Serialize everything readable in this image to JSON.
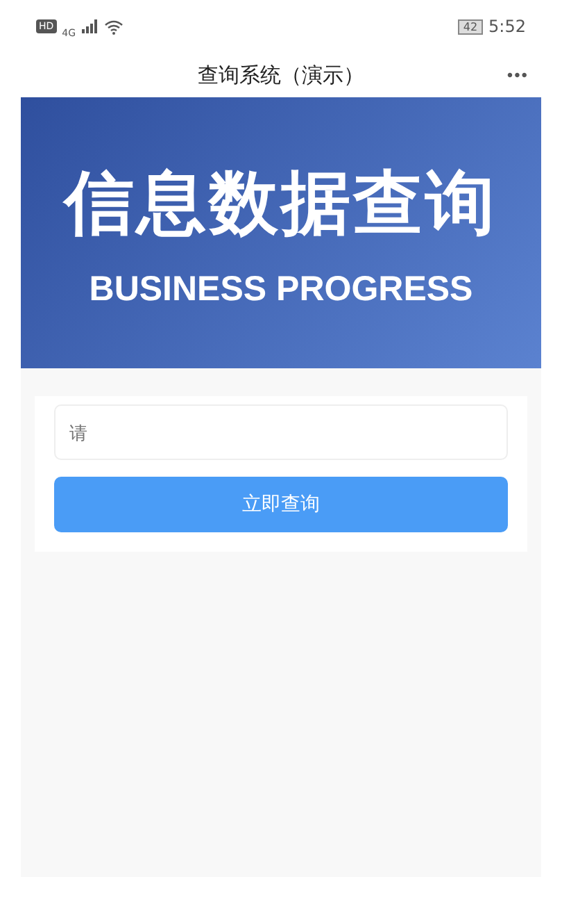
{
  "status_bar": {
    "hd": "HD",
    "network": "4G",
    "battery": "42",
    "time": "5:52"
  },
  "header": {
    "title": "查询系统（演示）",
    "menu": "•••"
  },
  "banner": {
    "title": "信息数据查询",
    "subtitle": "BUSINESS PROGRESS"
  },
  "form": {
    "search": {
      "placeholder": "请"
    },
    "button": "立即查询"
  }
}
